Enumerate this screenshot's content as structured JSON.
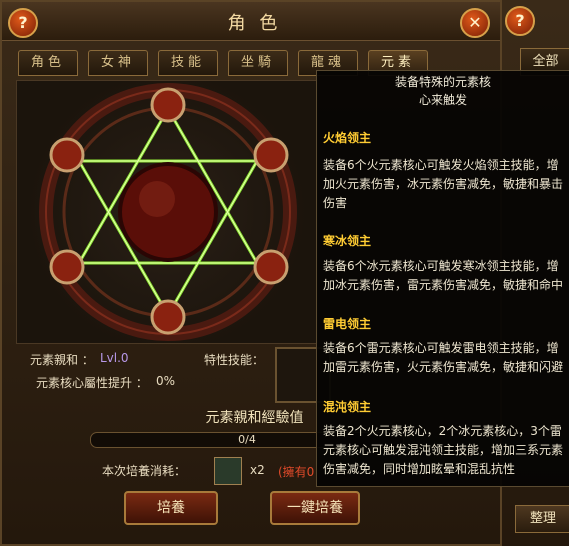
{
  "window": {
    "title": "角 色",
    "help_icon": "?",
    "close_icon": "✕"
  },
  "tabs": [
    {
      "label": "角色"
    },
    {
      "label": "女神"
    },
    {
      "label": "技能"
    },
    {
      "label": "坐騎"
    },
    {
      "label": "龍魂"
    },
    {
      "label": "元素"
    }
  ],
  "stats": {
    "affinity_label": "元素親和 ：",
    "affinity_value": "Lvl.0",
    "core_bonus_label": "元素核心屬性提升 ：",
    "core_bonus_value": "0%",
    "trait_skill_label": "特性技能："
  },
  "experience": {
    "title": "元素親和經驗值",
    "progress_text": "0/4",
    "progress": 0
  },
  "cost": {
    "label": "本次培養消耗：",
    "quantity": "x2",
    "owned": "(擁有0"
  },
  "buttons": {
    "cultivate": "培養",
    "one_click": "一鍵培養"
  },
  "side": {
    "tab_label": "全部",
    "sort_button": "整理",
    "help_icon": "?"
  },
  "tooltip": {
    "header_line1": "装备特殊的元素核",
    "header_line2": "心来触发",
    "sections": [
      {
        "title": "火焰领主",
        "lines": [
          "装备6个火元素核心可触发火焰领主技能，增",
          "加火元素伤害，冰元素伤害减免，敏捷和暴击",
          "伤害"
        ]
      },
      {
        "title": "寒冰领主",
        "lines": [
          "装备6个冰元素核心可触发寒冰领主技能，增",
          "加冰元素伤害，雷元素伤害减免，敏捷和命中"
        ]
      },
      {
        "title": "雷电领主",
        "lines": [
          "装备6个雷元素核心可触发雷电领主技能，增",
          "加雷元素伤害，火元素伤害减免，敏捷和闪避"
        ]
      },
      {
        "title": "混沌领主",
        "lines": [
          "装备2个火元素核心，2个冰元素核心，3个雷",
          "元素核心可触发混沌领主技能，增加三系元素",
          "伤害减免，同时增加眩晕和混乱抗性"
        ]
      }
    ]
  },
  "colors": {
    "accent": "#ffcc33",
    "glow": "#9bff3a",
    "panel": "#2c1d0d"
  }
}
